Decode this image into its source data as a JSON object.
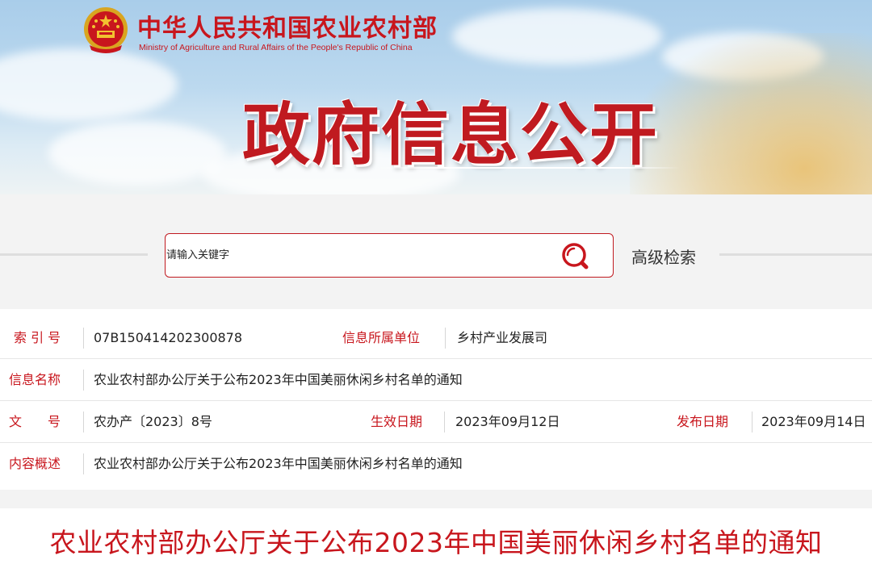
{
  "header": {
    "ministry_cn": "中华人民共和国农业农村部",
    "ministry_en": "Ministry of Agriculture and Rural Affairs of the People's Republic of China",
    "banner_title": "政府信息公开",
    "emblem_icon": "national-emblem-icon"
  },
  "search": {
    "placeholder": "请输入关键字",
    "search_icon": "search-icon",
    "advanced_label": "高级检索"
  },
  "meta": {
    "index_label": "索 引 号",
    "index_value": "07B150414202300878",
    "unit_label": "信息所属单位",
    "unit_value": "乡村产业发展司",
    "name_label": "信息名称",
    "name_value": "农业农村部办公厅关于公布2023年中国美丽休闲乡村名单的通知",
    "doc_label": "文　　号",
    "doc_value": "农办产〔2023〕8号",
    "effective_label": "生效日期",
    "effective_value": "2023年09月12日",
    "publish_label": "发布日期",
    "publish_value": "2023年09月14日",
    "summary_label": "内容概述",
    "summary_value": "农业农村部办公厅关于公布2023年中国美丽休闲乡村名单的通知"
  },
  "article": {
    "title": "农业农村部办公厅关于公布2023年中国美丽休闲乡村名单的通知"
  },
  "colors": {
    "accent_red": "#c8161d",
    "border_red": "#c01a20"
  }
}
